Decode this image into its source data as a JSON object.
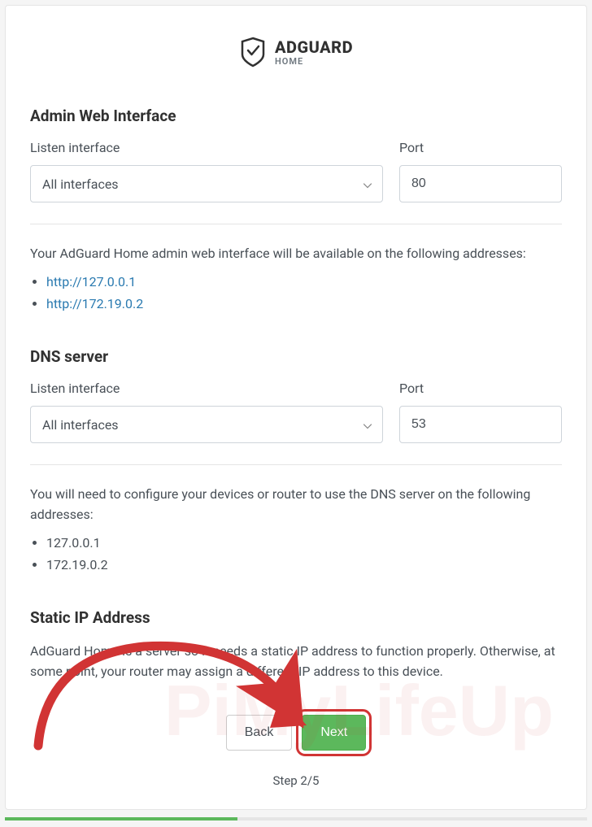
{
  "logo": {
    "brand": "ADGUARD",
    "sub": "HOME"
  },
  "admin": {
    "title": "Admin Web Interface",
    "listenLabel": "Listen interface",
    "listenValue": "All interfaces",
    "portLabel": "Port",
    "portValue": "80",
    "infoText": "Your AdGuard Home admin web interface will be available on the following addresses:",
    "addresses": [
      "http://127.0.0.1",
      "http://172.19.0.2"
    ]
  },
  "dns": {
    "title": "DNS server",
    "listenLabel": "Listen interface",
    "listenValue": "All interfaces",
    "portLabel": "Port",
    "portValue": "53",
    "infoText": "You will need to configure your devices or router to use the DNS server on the following addresses:",
    "addresses": [
      "127.0.0.1",
      "172.19.0.2"
    ]
  },
  "staticIp": {
    "title": "Static IP Address",
    "text": "AdGuard Home is a server so it needs a static IP address to function properly. Otherwise, at some point, your router may assign a different IP address to this device."
  },
  "buttons": {
    "back": "Back",
    "next": "Next"
  },
  "step": "Step 2/5",
  "watermark": "PiMyLifeUp"
}
